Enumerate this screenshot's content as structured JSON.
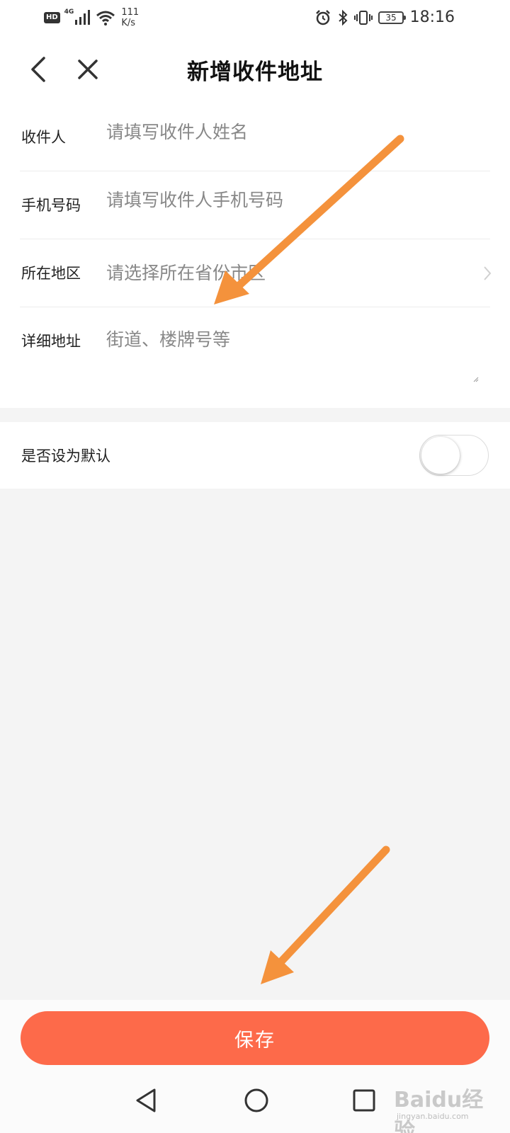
{
  "status_bar": {
    "hd": "HD",
    "network": "4G",
    "speed_value": "111",
    "speed_unit": "K/s",
    "battery": "35",
    "time": "18:16"
  },
  "header": {
    "title": "新增收件地址"
  },
  "form": {
    "recipient": {
      "label": "收件人",
      "placeholder": "请填写收件人姓名"
    },
    "phone": {
      "label": "手机号码",
      "placeholder": "请填写收件人手机号码"
    },
    "region": {
      "label": "所在地区",
      "placeholder": "请选择所在省份市区"
    },
    "address": {
      "label": "详细地址",
      "placeholder": "街道、楼牌号等"
    }
  },
  "default_setting": {
    "label": "是否设为默认",
    "enabled": false
  },
  "save_button": {
    "label": "保存"
  },
  "watermark": {
    "logo": "Baidu经验",
    "url": "jingyan.baidu.com"
  },
  "colors": {
    "accent": "#fd6a4a",
    "annotation_arrow": "#f4923c",
    "page_background": "#f4f4f4"
  }
}
